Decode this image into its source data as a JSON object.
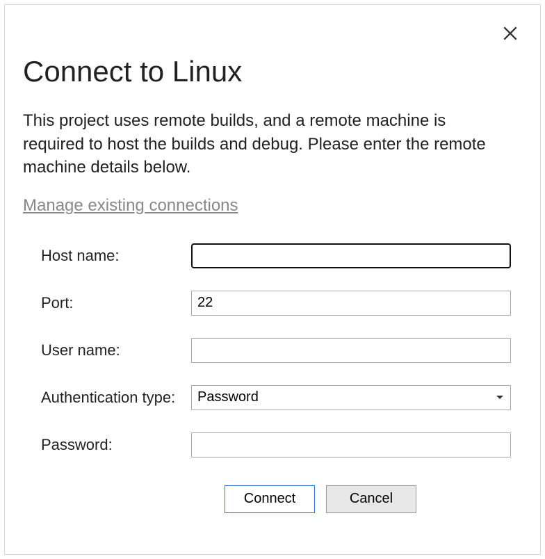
{
  "dialog": {
    "title": "Connect to Linux",
    "description": "This project uses remote builds, and a remote machine is required to host the builds and debug. Please enter the remote machine details below.",
    "manage_link": "Manage existing connections"
  },
  "form": {
    "hostname": {
      "label": "Host name:",
      "value": ""
    },
    "port": {
      "label": "Port:",
      "value": "22"
    },
    "username": {
      "label": "User name:",
      "value": ""
    },
    "authtype": {
      "label": "Authentication type:",
      "selected": "Password"
    },
    "password": {
      "label": "Password:",
      "value": ""
    }
  },
  "buttons": {
    "connect": "Connect",
    "cancel": "Cancel"
  }
}
